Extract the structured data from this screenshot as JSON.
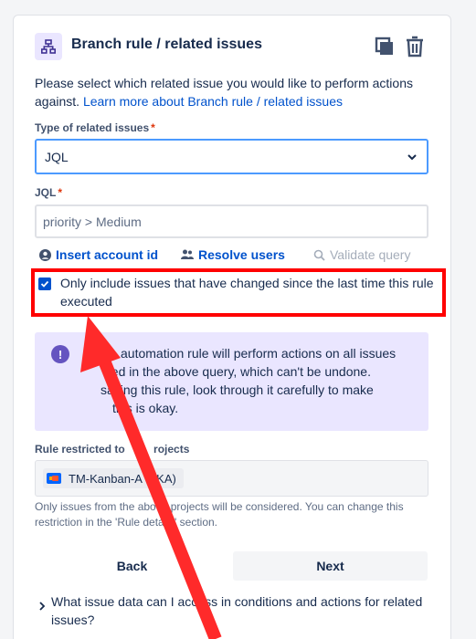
{
  "panel": {
    "title": "Branch rule / related issues",
    "intro_text": "Please select which related issue you would like to perform actions against. ",
    "intro_link": "Learn more about Branch rule / related issues",
    "type_label": "Type of related issues",
    "type_value": "JQL",
    "jql_label": "JQL",
    "jql_value": "priority > Medium",
    "insert_account_id": "Insert account id",
    "resolve_users": "Resolve users",
    "validate_query": "Validate query",
    "checkbox_label": "Only include issues that have changed since the last time this rule executed",
    "warning_visible_lines": [
      "automation rule will perform actions on all issues",
      "ned in the above query, which can't be undone.",
      "saving this rule, look through it carefully to make",
      "this is okay."
    ],
    "restricted_label_parts": [
      "Rule restricted to ",
      "rojects"
    ],
    "project_tag_parts": [
      "TM-Kanban-A (",
      "KA)"
    ],
    "helper_text": "Only issues from the above projects will be considered. You can change this restriction in the 'Rule details' section.",
    "back_label": "Back",
    "next_label": "Next",
    "faq_text": "What issue data can I access in conditions and actions for related issues?"
  },
  "colors": {
    "accent": "#0052cc",
    "warning_bg": "#eae6ff",
    "highlight": "#ff0000"
  },
  "icons": [
    "branch-icon",
    "copy-icon",
    "trash-icon",
    "chevron-down-icon",
    "user-icon",
    "users-icon",
    "search-icon",
    "check-icon",
    "info-icon",
    "project-avatar-icon",
    "chevron-right-icon"
  ]
}
